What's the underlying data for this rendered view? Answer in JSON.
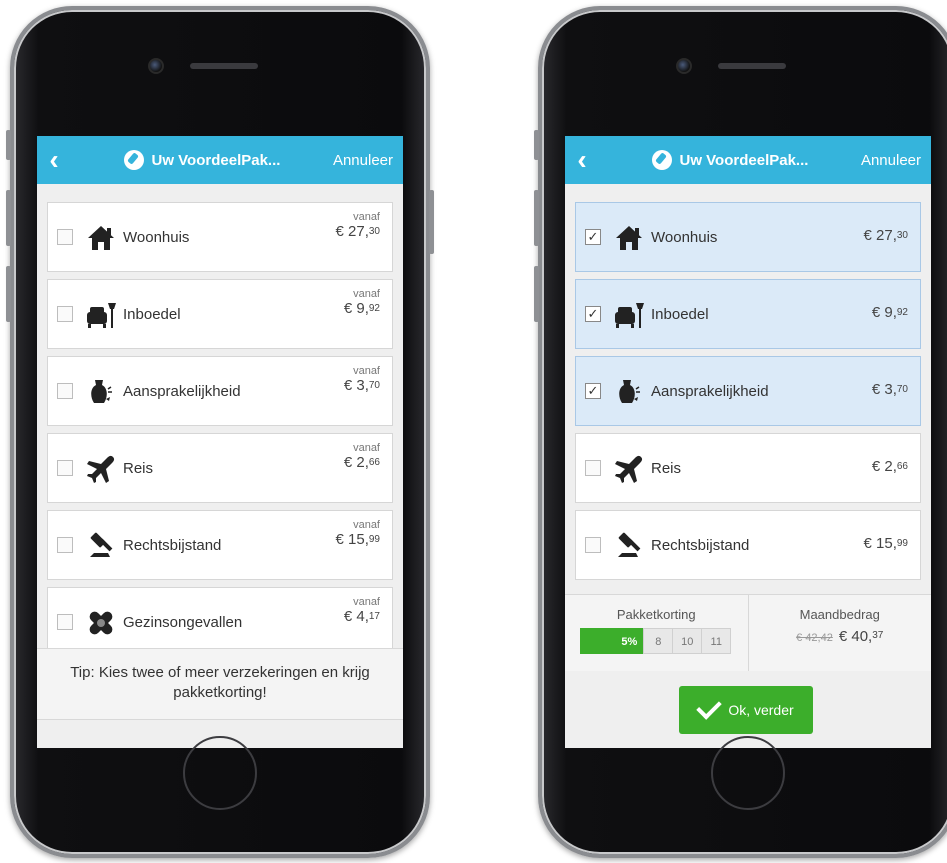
{
  "screens": [
    {
      "back_glyph": "‹",
      "title": "Uw VoordeelPak...",
      "cancel_label": "Annuleer",
      "items": [
        {
          "label": "Woonhuis",
          "vanaf": "vanaf",
          "price_main": "€ 27,",
          "price_cents": "30",
          "checked": false,
          "icon": "house-icon"
        },
        {
          "label": "Inboedel",
          "vanaf": "vanaf",
          "price_main": "€ 9,",
          "price_cents": "92",
          "checked": false,
          "icon": "armchair-lamp-icon"
        },
        {
          "label": "Aansprakelijkheid",
          "vanaf": "vanaf",
          "price_main": "€ 3,",
          "price_cents": "70",
          "checked": false,
          "icon": "broken-vase-icon"
        },
        {
          "label": "Reis",
          "vanaf": "vanaf",
          "price_main": "€ 2,",
          "price_cents": "66",
          "checked": false,
          "icon": "airplane-icon"
        },
        {
          "label": "Rechtsbijstand",
          "vanaf": "vanaf",
          "price_main": "€ 15,",
          "price_cents": "99",
          "checked": false,
          "icon": "gavel-icon"
        },
        {
          "label": "Gezinsongevallen",
          "vanaf": "vanaf",
          "price_main": "€ 4,",
          "price_cents": "17",
          "checked": false,
          "icon": "bandage-icon"
        }
      ],
      "tip": "Tip: Kies twee of meer verzekeringen en krijg pakketkorting!"
    },
    {
      "back_glyph": "‹",
      "title": "Uw VoordeelPak...",
      "cancel_label": "Annuleer",
      "items": [
        {
          "label": "Woonhuis",
          "price_main": "€ 27,",
          "price_cents": "30",
          "checked": true,
          "icon": "house-icon"
        },
        {
          "label": "Inboedel",
          "price_main": "€ 9,",
          "price_cents": "92",
          "checked": true,
          "icon": "armchair-lamp-icon"
        },
        {
          "label": "Aansprakelijkheid",
          "price_main": "€ 3,",
          "price_cents": "70",
          "checked": true,
          "icon": "broken-vase-icon"
        },
        {
          "label": "Reis",
          "price_main": "€ 2,",
          "price_cents": "66",
          "checked": false,
          "icon": "airplane-icon"
        },
        {
          "label": "Rechtsbijstand",
          "price_main": "€ 15,",
          "price_cents": "99",
          "checked": false,
          "icon": "gavel-icon"
        }
      ],
      "discount": {
        "label": "Pakketkorting",
        "active": "5%",
        "levels": [
          "8",
          "10",
          "11"
        ]
      },
      "monthly": {
        "label": "Maandbedrag",
        "old": "€ 42,42",
        "new_main": "€ 40,",
        "new_cents": "37"
      },
      "ok_label": "Ok, verder"
    }
  ],
  "colors": {
    "navbar": "#35b4dc",
    "selected": "#dbeaf8",
    "green": "#3cae2b"
  }
}
